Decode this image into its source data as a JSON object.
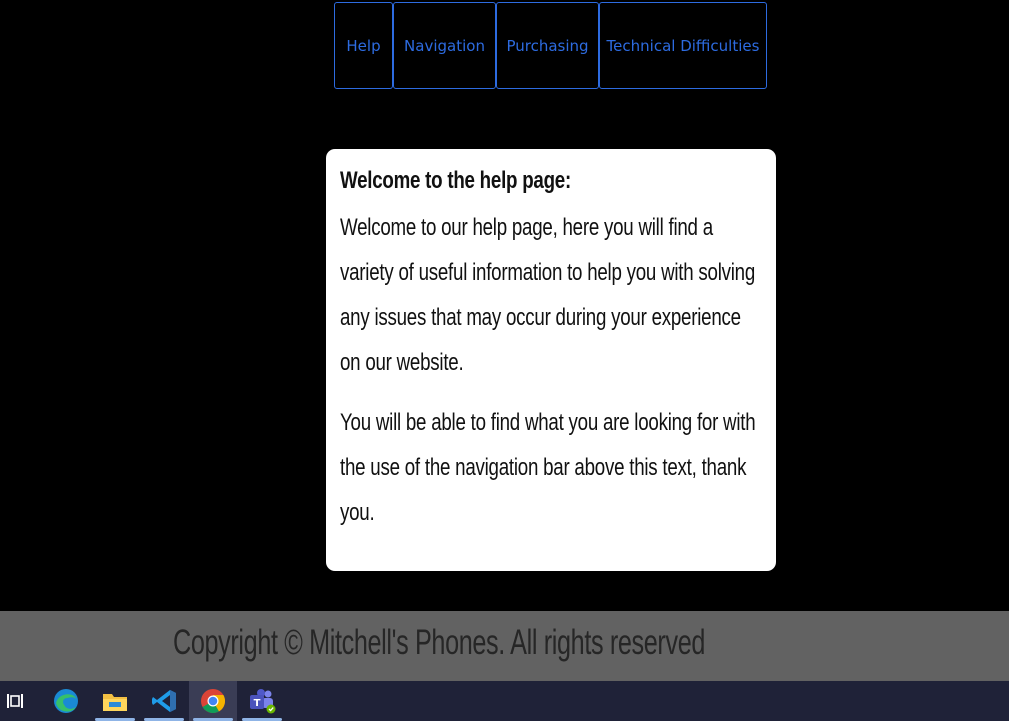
{
  "nav": {
    "items": [
      {
        "label": "Help"
      },
      {
        "label": "Navigation"
      },
      {
        "label": "Purchasing"
      },
      {
        "label": "Technical Difficulties"
      }
    ]
  },
  "main": {
    "title": "Welcome to the help page:",
    "paragraphs": [
      "Welcome to our help page, here you will find a variety of useful information to help you with solving any issues that may occur during your experience on our website.",
      "You will be able to find what you are looking for with the use of the navigation bar above this text, thank you."
    ]
  },
  "footer": {
    "text": "Copyright © Mitchell's Phones. All rights reserved"
  },
  "taskbar": {
    "items": [
      {
        "icon": "task-view-icon"
      },
      {
        "icon": "edge-icon"
      },
      {
        "icon": "file-explorer-icon"
      },
      {
        "icon": "vscode-icon"
      },
      {
        "icon": "chrome-icon",
        "active": true
      },
      {
        "icon": "teams-icon"
      }
    ]
  },
  "colors": {
    "background": "#000000",
    "accent": "#2d6be0",
    "card": "#ffffff",
    "footer": "#626262",
    "taskbar": "#1f2238"
  }
}
